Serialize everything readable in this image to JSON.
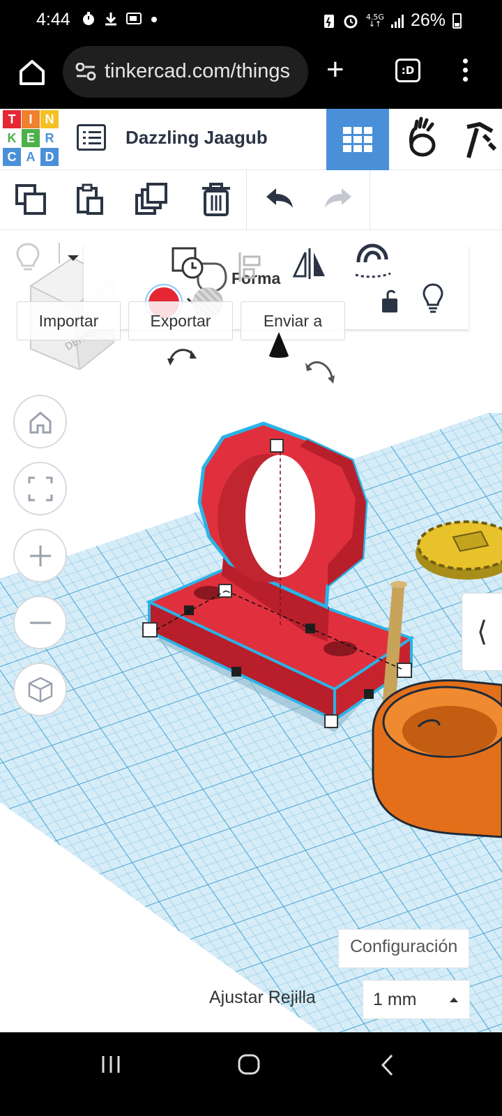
{
  "status_bar": {
    "time": "4:44",
    "network": "4.5G",
    "battery_pct": "26%"
  },
  "browser": {
    "url": "tinkercad.com/things",
    "tabs_count": ":D"
  },
  "header": {
    "logo_letters": [
      "T",
      "I",
      "N",
      "K",
      "E",
      "R",
      "C",
      "A",
      "D"
    ],
    "design_name": "Dazzling Jaagub"
  },
  "panel": {
    "shape_label": "Forma",
    "import_label": "Importar",
    "export_label": "Exportar",
    "send_label": "Enviar a"
  },
  "workspace": {
    "viewcube_text": "DERAS",
    "settings_label": "Configuración",
    "snap_grid_label": "Ajustar Rejilla",
    "snap_grid_value": "1 mm",
    "side_panel_toggle": "⟨"
  },
  "colors": {
    "tinkercad_red": "#e52734",
    "tinkercad_orange": "#f0812f",
    "tinkercad_blue": "#4a90d9",
    "tinkercad_yellow": "#f5c024",
    "grid_blue": "#a9d5eb",
    "selection_outline": "#2ab3e6"
  }
}
